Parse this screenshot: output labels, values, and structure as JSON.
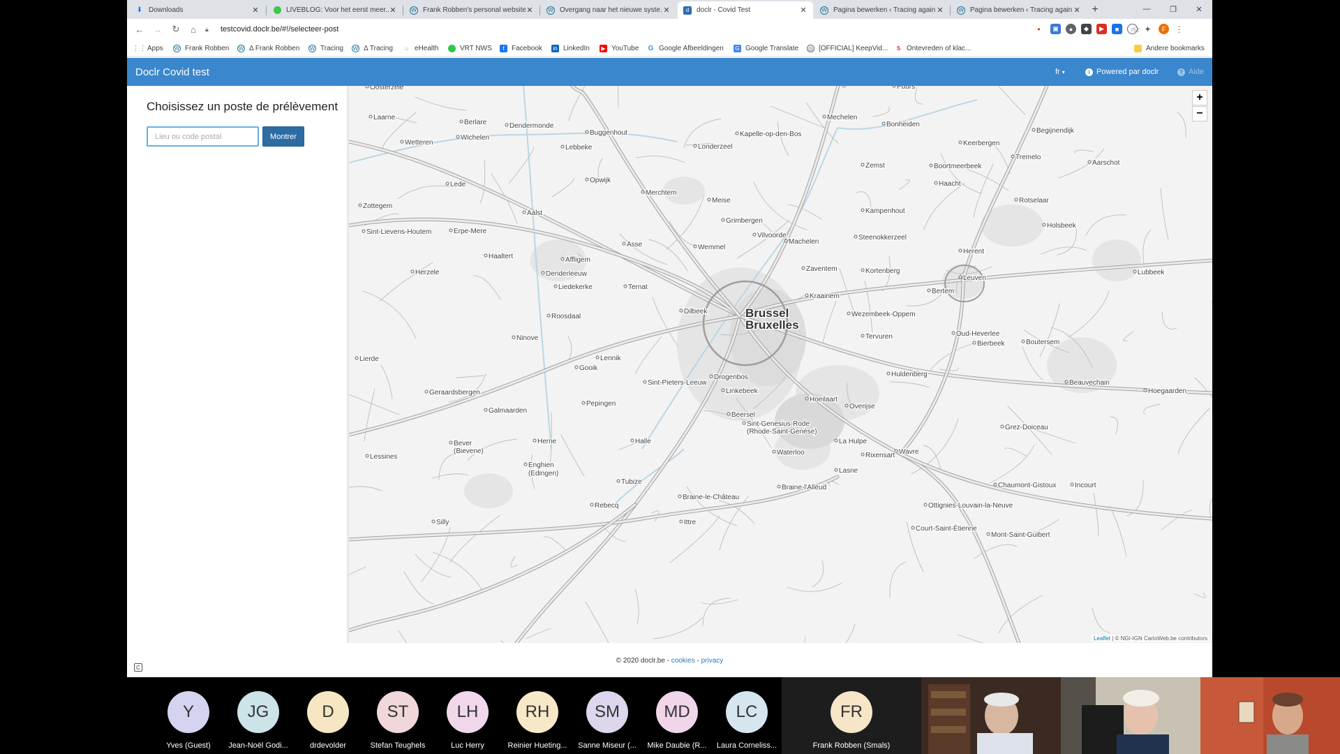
{
  "tabs": [
    {
      "title": "Downloads",
      "icon": "download-icon",
      "active": false
    },
    {
      "title": "LIVEBLOG: Voor het eerst meer...",
      "icon": "liveblog-icon",
      "active": false
    },
    {
      "title": "Frank Robben's personal website",
      "icon": "wordpress-icon",
      "active": false
    },
    {
      "title": "Overgang naar het nieuwe syste...",
      "icon": "wordpress-icon",
      "active": false
    },
    {
      "title": "doclr - Covid Test",
      "icon": "doclr-icon",
      "active": true
    },
    {
      "title": "Pagina bewerken ‹ Tracing again...",
      "icon": "wordpress-icon",
      "active": false
    },
    {
      "title": "Pagina bewerken ‹ Tracing again...",
      "icon": "wordpress-icon",
      "active": false
    }
  ],
  "address_bar": {
    "url": "testcovid.doclr.be/#!/selecteer-post"
  },
  "bookmarks": [
    "Apps",
    "Frank Robben",
    "Δ Frank Robben",
    "Tracing",
    "Δ Tracing",
    "eHealth",
    "VRT NWS",
    "Facebook",
    "LinkedIn",
    "YouTube",
    "Google Afbeeldingen",
    "Google Translate",
    "[OFFICIAL] KeepVid...",
    "Ontevreden of klac..."
  ],
  "other_bookmarks": "Andere bookmarks",
  "app": {
    "brand": "Doclr Covid test",
    "language": "fr",
    "powered_by": "Powered par doclr",
    "help": "Aide"
  },
  "sidebar": {
    "title": "Choisissez un poste de prélèvement",
    "search_placeholder": "Lieu ou code postal",
    "search_value": "",
    "show_button": "Montrer"
  },
  "map": {
    "zoom_in": "+",
    "zoom_out": "−",
    "attribution_leaflet": "Leaflet",
    "attribution_rest": "| © NGI-IGN CartoWeb.be contributors",
    "places": [
      {
        "name": "Dendermonde",
        "major": false
      },
      {
        "name": "Mechelen",
        "major": false
      },
      {
        "name": "Aalst",
        "major": false
      },
      {
        "name": "Vilvoorde",
        "major": false
      },
      {
        "name": "Leuven",
        "major": false
      },
      {
        "name": "Brussel",
        "major": true
      },
      {
        "name": "Bruxelles",
        "major": true
      },
      {
        "name": "Halle",
        "major": false
      },
      {
        "name": "Wavre",
        "major": false
      },
      {
        "name": "Ninove",
        "major": false
      },
      {
        "name": "Lennik",
        "major": false
      },
      {
        "name": "Gooik",
        "major": false
      },
      {
        "name": "Geraardsbergen",
        "major": false
      },
      {
        "name": "Wetteren",
        "major": false
      },
      {
        "name": "Lede",
        "major": false
      },
      {
        "name": "Erpe-Mere",
        "major": false
      },
      {
        "name": "Haaltert",
        "major": false
      },
      {
        "name": "Herzele",
        "major": false
      },
      {
        "name": "Affligem",
        "major": false
      },
      {
        "name": "Denderleeuw",
        "major": false
      },
      {
        "name": "Liedekerke",
        "major": false
      },
      {
        "name": "Ternat",
        "major": false
      },
      {
        "name": "Asse",
        "major": false
      },
      {
        "name": "Wemmel",
        "major": false
      },
      {
        "name": "Grimbergen",
        "major": false
      },
      {
        "name": "Machelen",
        "major": false
      },
      {
        "name": "Zaventem",
        "major": false
      },
      {
        "name": "Kortenberg",
        "major": false
      },
      {
        "name": "Kraainem",
        "major": false
      },
      {
        "name": "Wezembeek-Oppem",
        "major": false
      },
      {
        "name": "Tervuren",
        "major": false
      },
      {
        "name": "Dilbeek",
        "major": false
      },
      {
        "name": "Roosdaal",
        "major": false
      },
      {
        "name": "Sint-Pieters-Leeuw",
        "major": false
      },
      {
        "name": "Drogenbos",
        "major": false
      },
      {
        "name": "Linkebeek",
        "major": false
      },
      {
        "name": "Beersel",
        "major": false
      },
      {
        "name": "Sint-Genesius-Rode",
        "major": false
      },
      {
        "name": "(Rhode-Saint-Genèse)",
        "major": false
      },
      {
        "name": "Hoeilaart",
        "major": false
      },
      {
        "name": "Overijse",
        "major": false
      },
      {
        "name": "Huldenberg",
        "major": false
      },
      {
        "name": "Oud-Heverlee",
        "major": false
      },
      {
        "name": "Bierbeek",
        "major": false
      },
      {
        "name": "Boutersem",
        "major": false
      },
      {
        "name": "Beauvechain",
        "major": false
      },
      {
        "name": "Grez-Doiceau",
        "major": false
      },
      {
        "name": "La Hulpe",
        "major": false
      },
      {
        "name": "Rixensart",
        "major": false
      },
      {
        "name": "Waterloo",
        "major": false
      },
      {
        "name": "Lasne",
        "major": false
      },
      {
        "name": "Braine-l'Alleud",
        "major": false
      },
      {
        "name": "Braine-le-Château",
        "major": false
      },
      {
        "name": "Tubize",
        "major": false
      },
      {
        "name": "Rebecq",
        "major": false
      },
      {
        "name": "Enghien",
        "major": false
      },
      {
        "name": "(Edingen)",
        "major": false
      },
      {
        "name": "Herne",
        "major": false
      },
      {
        "name": "Pepingen",
        "major": false
      },
      {
        "name": "Galmaarden",
        "major": false
      },
      {
        "name": "Bever",
        "major": false
      },
      {
        "name": "(Bievene)",
        "major": false
      },
      {
        "name": "Lessines",
        "major": false
      },
      {
        "name": "Silly",
        "major": false
      },
      {
        "name": "Ittre",
        "major": false
      },
      {
        "name": "Ottignies-Louvain-la-Neuve",
        "major": false
      },
      {
        "name": "Court-Saint-Étienne",
        "major": false
      },
      {
        "name": "Mont-Saint-Guibert",
        "major": false
      },
      {
        "name": "Chaumont-Gistoux",
        "major": false
      },
      {
        "name": "Incourt",
        "major": false
      },
      {
        "name": "Bertem",
        "major": false
      },
      {
        "name": "Herent",
        "major": false
      },
      {
        "name": "Holsbeek",
        "major": false
      },
      {
        "name": "Rotselaar",
        "major": false
      },
      {
        "name": "Kampenhout",
        "major": false
      },
      {
        "name": "Steenokkerzeel",
        "major": false
      },
      {
        "name": "Haacht",
        "major": false
      },
      {
        "name": "Boortmeerbeek",
        "major": false
      },
      {
        "name": "Zemst",
        "major": false
      },
      {
        "name": "Keerbergen",
        "major": false
      },
      {
        "name": "Tremelo",
        "major": false
      },
      {
        "name": "Aarschot",
        "major": false
      },
      {
        "name": "Begijnendijk",
        "major": false
      },
      {
        "name": "Bonheiden",
        "major": false
      },
      {
        "name": "Kapelle-op-den-Bos",
        "major": false
      },
      {
        "name": "Londerzeel",
        "major": false
      },
      {
        "name": "Meise",
        "major": false
      },
      {
        "name": "Merchtem",
        "major": false
      },
      {
        "name": "Opwijk",
        "major": false
      },
      {
        "name": "Buggenhout",
        "major": false
      },
      {
        "name": "Lebbeke",
        "major": false
      },
      {
        "name": "Berlare",
        "major": false
      },
      {
        "name": "Wichelen",
        "major": false
      },
      {
        "name": "Laarne",
        "major": false
      },
      {
        "name": "Puurs",
        "major": false
      },
      {
        "name": "Lubbeek",
        "major": false
      },
      {
        "name": "Hoegaarden",
        "major": false
      },
      {
        "name": "Sint-Lievens-Houtem",
        "major": false
      },
      {
        "name": "Zottegem",
        "major": false
      },
      {
        "name": "Oosterzele",
        "major": false
      },
      {
        "name": "Lierde",
        "major": false
      }
    ]
  },
  "footer": {
    "copyright": "© 2020 doclr.be - ",
    "cookies": "cookies",
    "sep": " - ",
    "privacy": "privacy"
  },
  "participants": [
    {
      "initials": "Y",
      "name": "Yves (Guest)",
      "color": "#d4d4f0"
    },
    {
      "initials": "JG",
      "name": "Jean-Noël Godi...",
      "color": "#cce3e8"
    },
    {
      "initials": "D",
      "name": "drdevolder",
      "color": "#f6e6c3"
    },
    {
      "initials": "ST",
      "name": "Stefan Teughels",
      "color": "#f0d7da"
    },
    {
      "initials": "LH",
      "name": "Luc Herry",
      "color": "#f1d7ea"
    },
    {
      "initials": "RH",
      "name": "Reinier Hueting...",
      "color": "#f7e9c7"
    },
    {
      "initials": "SM",
      "name": "Sanne Miseur (...",
      "color": "#ddd6ec"
    },
    {
      "initials": "MD",
      "name": "Mike Daubie (R...",
      "color": "#f0d6e8"
    },
    {
      "initials": "LC",
      "name": "Laura Corneliss...",
      "color": "#d6e6ee"
    }
  ],
  "active_speaker": {
    "initials": "FR",
    "name": "Frank Robben (Smals)",
    "color": "#f6e5c6"
  }
}
